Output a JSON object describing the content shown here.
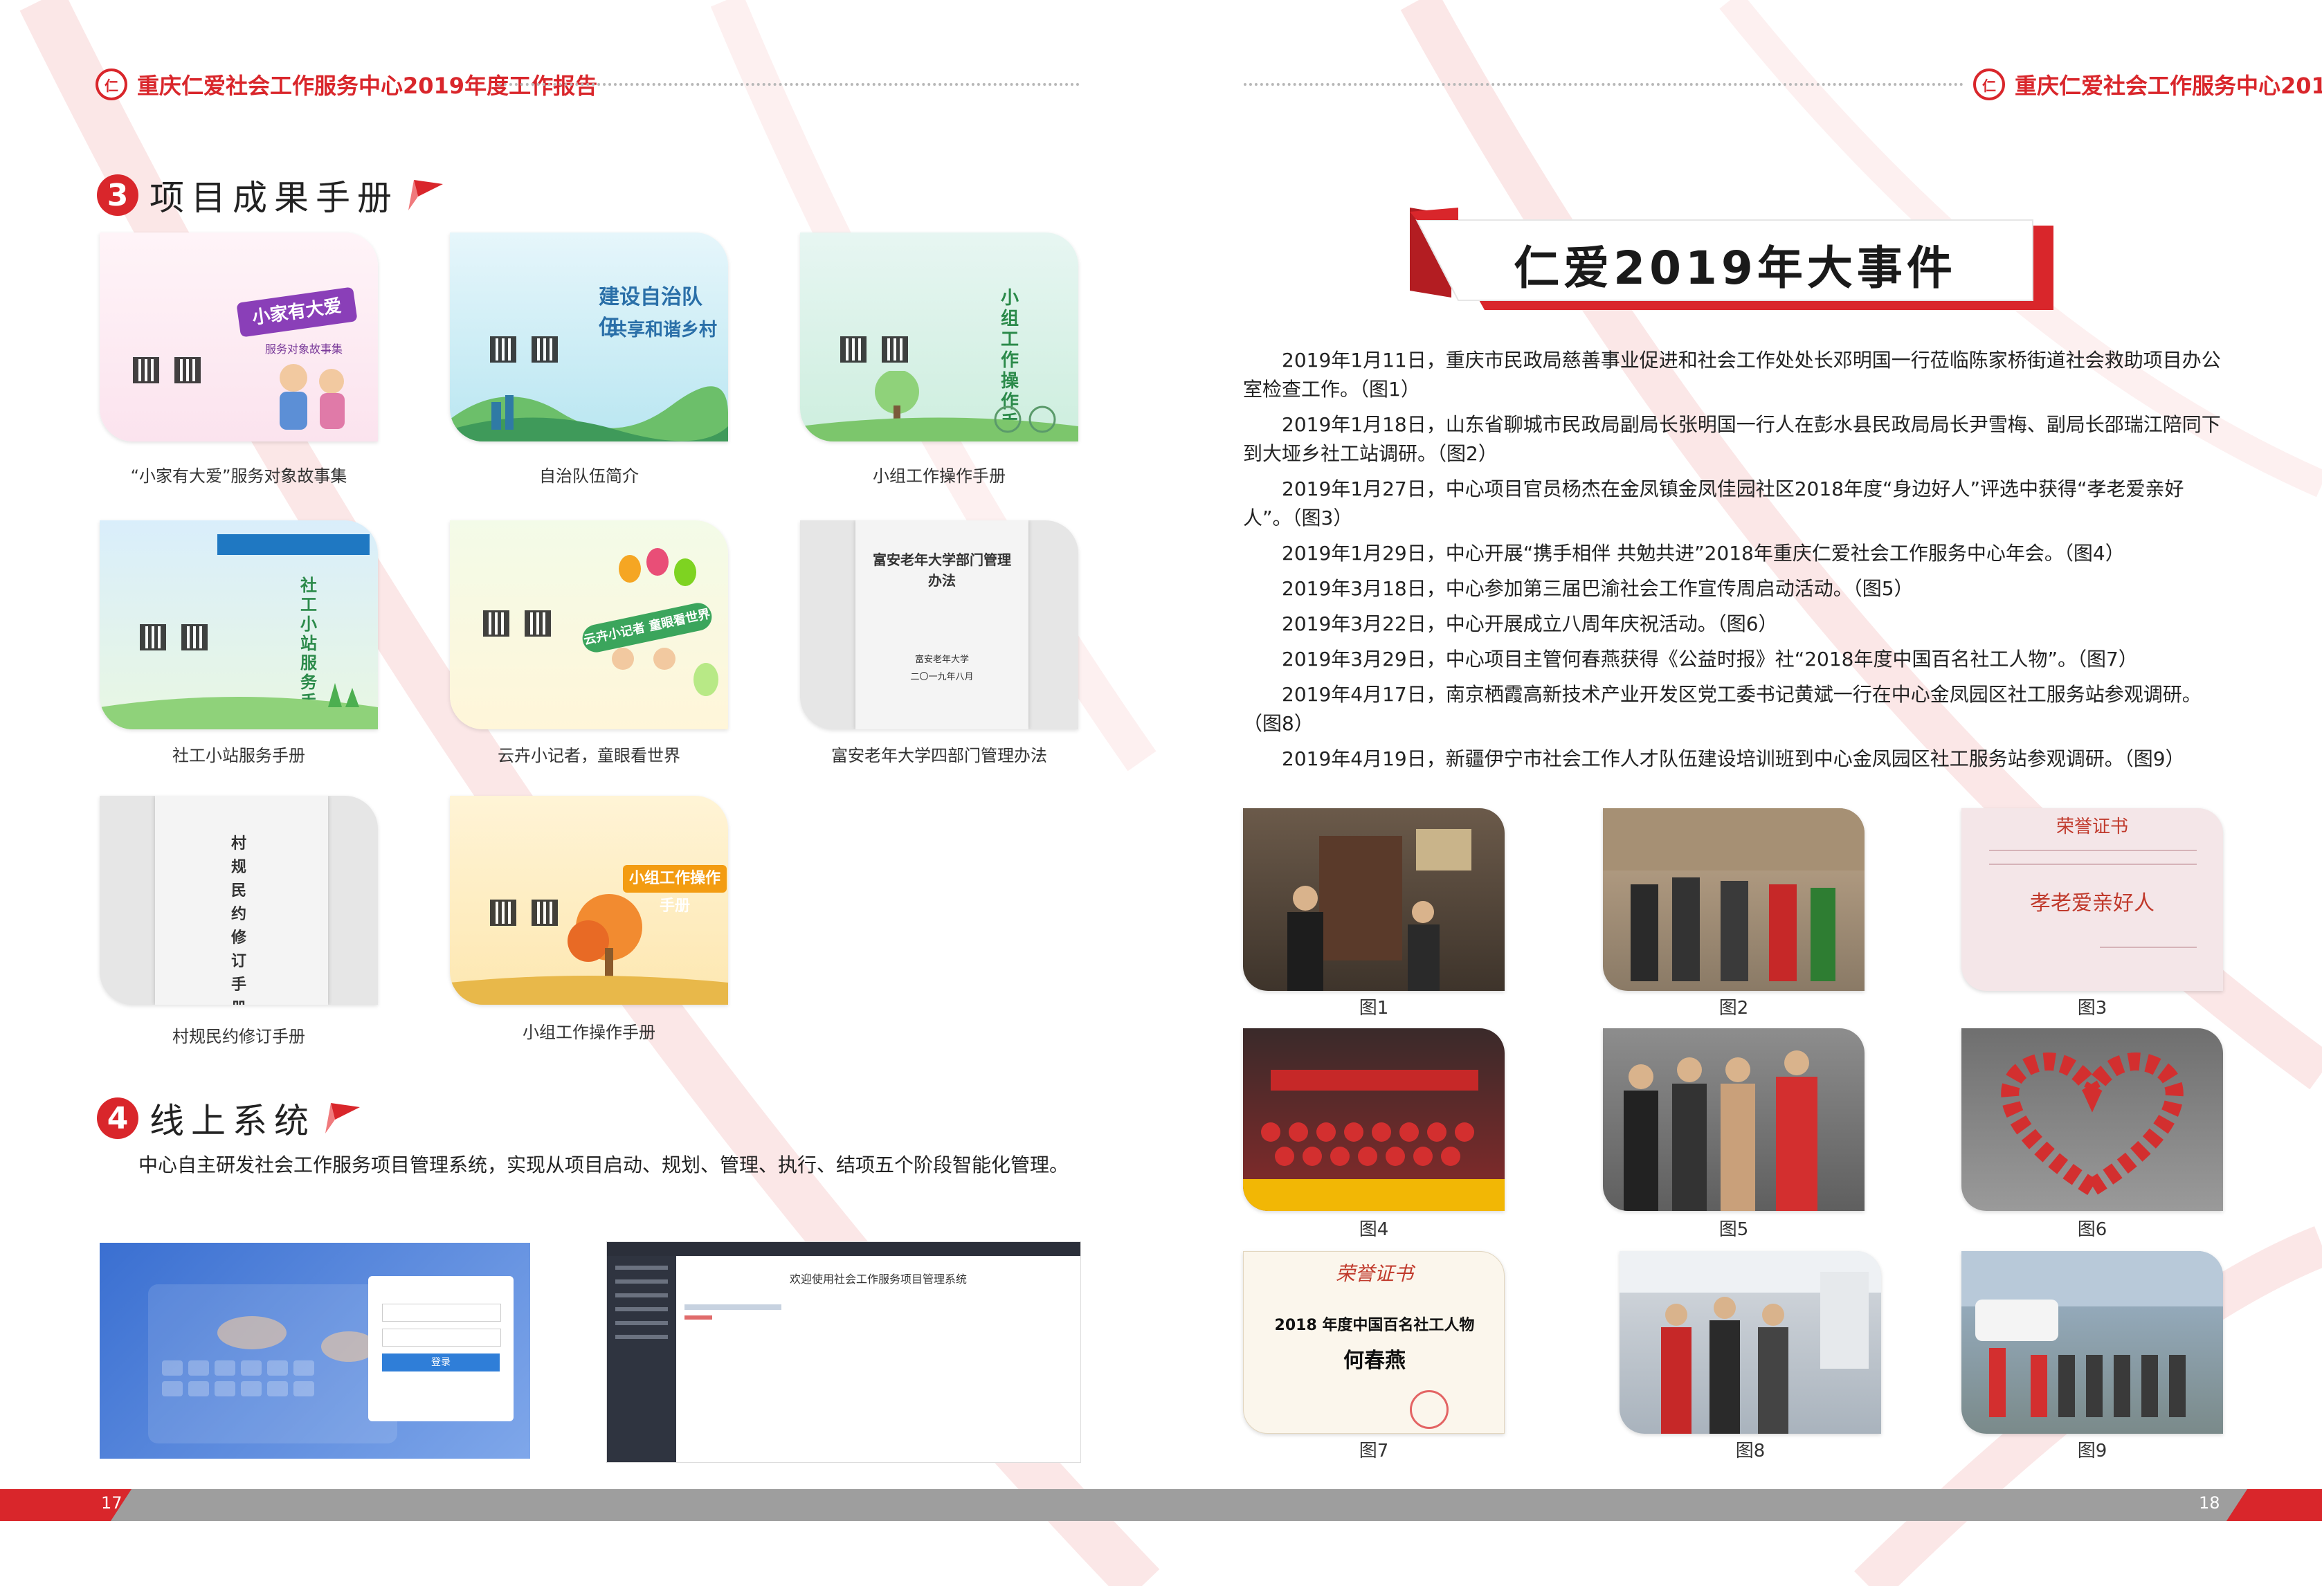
{
  "header": {
    "logo": "仁",
    "title": "重庆仁爱社会工作服务中心2019年度工作报告"
  },
  "section3": {
    "number": "3",
    "title": "项目成果手册",
    "items": [
      {
        "caption": "“小家有大爱”服务对象故事集",
        "cover_text": "小家有大爱",
        "cover_sub": "服务对象故事集"
      },
      {
        "caption": "自治队伍简介",
        "cover_text": "建设自治队伍",
        "cover_sub": "共享和谐乡村"
      },
      {
        "caption": "小组工作操作手册",
        "cover_text": "小组工作操作手册"
      },
      {
        "caption": "社工小站服务手册",
        "cover_text": "社工小站服务手册"
      },
      {
        "caption": "云卉小记者，童眼看世界",
        "cover_text": "云卉小记者 童眼看世界"
      },
      {
        "caption": "富安老年大学四部门管理办法",
        "cover_text": "富安老年大学部门管理办法",
        "cover_sub": "富安老年大学",
        "cover_date": "二〇一九年八月"
      },
      {
        "caption": "村规民约修订手册",
        "cover_text": "村规民约修订手册"
      },
      {
        "caption": "小组工作操作手册",
        "cover_text": "小组工作操作手册"
      }
    ]
  },
  "section4": {
    "number": "4",
    "title": "线上系统",
    "paragraph": "中心自主研发社会工作服务项目管理系统，实现从项目启动、规划、管理、执行、结项五个阶段智能化管理。",
    "login": {
      "button": "登录"
    },
    "system": {
      "welcome": "欢迎使用社会工作服务项目管理系统"
    }
  },
  "footer": {
    "left_page": "17",
    "right_page": "18"
  },
  "events_title": "仁爱2019年大事件",
  "events": [
    "2019年1月11日，重庆市民政局慈善事业促进和社会工作处处长邓明国一行莅临陈家桥街道社会救助项目办公室检查工作。（图1）",
    "2019年1月18日，山东省聊城市民政局副局长张明国一行人在彭水县民政局局长尹雪梅、副局长邵瑞江陪同下到大垭乡社工站调研。（图2）",
    "2019年1月27日，中心项目官员杨杰在金凤镇金凤佳园社区2018年度“身边好人”评选中获得“孝老爱亲好人”。（图3）",
    "2019年1月29日，中心开展“携手相伴 共勉共进”2018年重庆仁爱社会工作服务中心年会。（图4）",
    "2019年3月18日，中心参加第三届巴渝社会工作宣传周启动活动。（图5）",
    "2019年3月22日，中心开展成立八周年庆祝活动。（图6）",
    "2019年3月29日，中心项目主管何春燕获得《公益时报》社“2018年度中国百名社工人物”。（图7）",
    "2019年4月17日，南京栖霞高新技术产业开发区党工委书记黄斌一行在中心金凤园区社工服务站参观调研。（图8）",
    "2019年4月19日，新疆伊宁市社会工作人才队伍建设培训班到中心金凤园区社工服务站参观调研。（图9）"
  ],
  "photos": [
    {
      "caption": "图1"
    },
    {
      "caption": "图2"
    },
    {
      "caption": "图3",
      "cert_title": "荣誉证书",
      "cert_body": "孝老爱亲好人"
    },
    {
      "caption": "图4"
    },
    {
      "caption": "图5"
    },
    {
      "caption": "图6"
    },
    {
      "caption": "图7",
      "cert_title": "荣誉证书",
      "cert_line": "2018 年度中国百名社工人物",
      "cert_name": "何春燕"
    },
    {
      "caption": "图8"
    },
    {
      "caption": "图9"
    }
  ],
  "colors": {
    "accent": "#d9262b",
    "footer_gray": "#9e9e9e"
  }
}
